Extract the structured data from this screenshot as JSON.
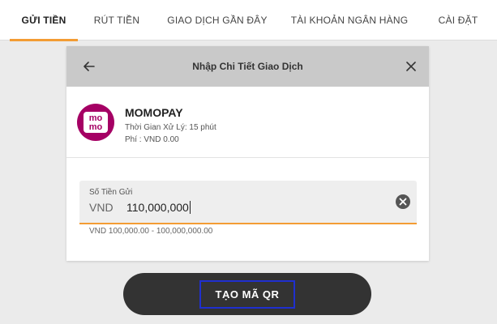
{
  "tabs": [
    {
      "label": "GỬI TIỀN",
      "active": true
    },
    {
      "label": "RÚT TIỀN",
      "active": false
    },
    {
      "label": "GIAO DỊCH GẦN ĐÂY",
      "active": false
    },
    {
      "label": "TÀI KHOẢN NGÂN HÀNG",
      "active": false
    },
    {
      "label": "CÀI ĐẶT",
      "active": false
    }
  ],
  "dialog": {
    "title": "Nhập Chi Tiết Giao Dịch",
    "back_icon": "arrow-left-icon",
    "close_icon": "close-icon"
  },
  "provider": {
    "name": "MOMOPAY",
    "processing_time": "Thời Gian Xử Lý: 15 phút",
    "fee": "Phí : VND 0.00",
    "logo_text_top": "mo",
    "logo_text_bottom": "mo",
    "logo_color": "#a50064"
  },
  "amount": {
    "label": "Số Tiền Gửi",
    "currency": "VND",
    "value": "110,000,000",
    "range_hint": "VND 100,000.00 - 100,000,000.00",
    "clear_icon": "clear-circle-icon"
  },
  "submit": {
    "label": "TẠO MÃ QR"
  },
  "colors": {
    "accent": "#f39c34",
    "header_bg": "#c9c9c9",
    "button_bg": "#333333",
    "focus_outline": "#1f2fcf"
  }
}
